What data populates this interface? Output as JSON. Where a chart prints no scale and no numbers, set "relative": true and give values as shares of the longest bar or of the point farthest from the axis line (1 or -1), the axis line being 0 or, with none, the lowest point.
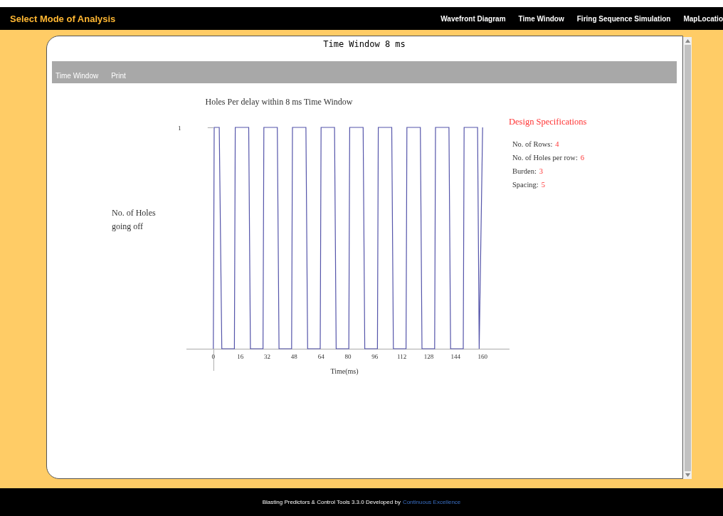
{
  "header": {
    "title": "Select Mode of Analysis",
    "nav": [
      {
        "label": "Wavefront Diagram",
        "selected": false
      },
      {
        "label": "Time Window",
        "selected": false
      },
      {
        "label": "Firing Sequence Simulation",
        "selected": false
      },
      {
        "label": "MapLocatio",
        "selected": false
      }
    ]
  },
  "panel": {
    "title": "Time Window 8 ms",
    "toolbar": [
      "Time Window",
      "Print"
    ],
    "chart_data": {
      "type": "line",
      "title": "Holes Per delay within 8 ms Time Window",
      "xlabel": "Time(ms)",
      "x": [
        0,
        0.5,
        3.5,
        5,
        12.5,
        13,
        21,
        22,
        29.5,
        30,
        38,
        39,
        46.5,
        47,
        55,
        56,
        63.5,
        64,
        72,
        73,
        80.5,
        81,
        89,
        90,
        97.5,
        98,
        106,
        107,
        114.5,
        115,
        123,
        124,
        131.5,
        132,
        140,
        141,
        148.5,
        149,
        157,
        158,
        160
      ],
      "series": [
        {
          "color": "#5555aa",
          "values": [
            0,
            1,
            1,
            0,
            0,
            1,
            1,
            0,
            0,
            1,
            1,
            0,
            0,
            1,
            1,
            0,
            0,
            1,
            1,
            0,
            0,
            1,
            1,
            0,
            0,
            1,
            1,
            0,
            0,
            1,
            1,
            0,
            0,
            1,
            1,
            0,
            0,
            1,
            1,
            0,
            1
          ]
        }
      ],
      "xticks": [
        0,
        16,
        32,
        48,
        64,
        80,
        96,
        112,
        128,
        144,
        160
      ],
      "xlim": [
        -16,
        176
      ],
      "relative": true,
      "annotations": [
        "1",
        "No. of Holes going off"
      ]
    },
    "specs": {
      "heading": "Design Specifications",
      "items": [
        {
          "label": "No. of Rows:",
          "value": "4"
        },
        {
          "label": "No. of Holes per row:",
          "value": "6"
        },
        {
          "label": "Burden:",
          "value": "3"
        },
        {
          "label": "Spacing:",
          "value": "5"
        }
      ]
    }
  },
  "footer": {
    "text": "Blasting Predictors & Control Tools 3.3.0 Developed by",
    "link": "Continuous Excellence"
  }
}
